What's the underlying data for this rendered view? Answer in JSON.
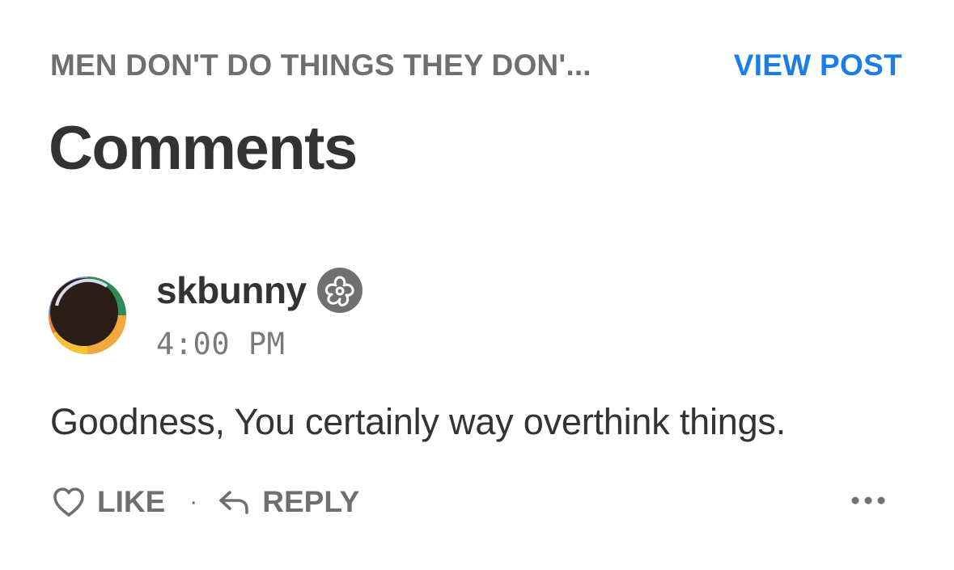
{
  "header": {
    "post_title": "MEN DON'T DO THINGS THEY DON'...",
    "view_post_label": "VIEW POST"
  },
  "page": {
    "heading": "Comments"
  },
  "comment": {
    "username": "skbunny",
    "badge_icon": "flower-badge-icon",
    "timestamp": "4:00 PM",
    "body": "Goodness, You certainly way overthink things.",
    "actions": {
      "like_label": "LIKE",
      "separator": "·",
      "reply_label": "REPLY",
      "more_icon": "more-options-icon"
    }
  },
  "colors": {
    "accent": "#1a7ee6",
    "muted": "#6f6f6f",
    "text": "#333333"
  }
}
